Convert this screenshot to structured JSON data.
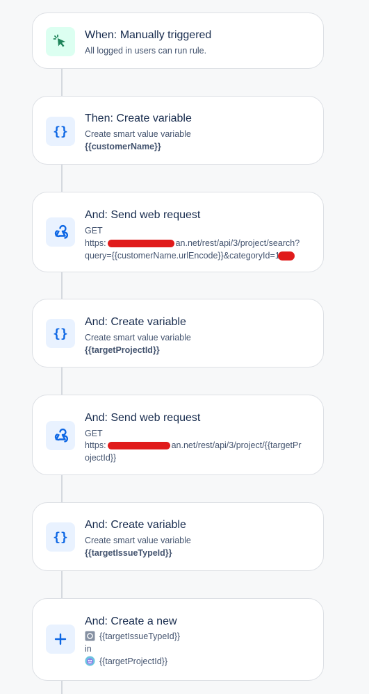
{
  "steps": [
    {
      "title": "When: Manually triggered",
      "subtitle": "All logged in users can run rule."
    },
    {
      "title": "Then: Create variable",
      "line1": "Create smart value variable",
      "value": "{{customerName}}"
    },
    {
      "title": "And: Send web request",
      "method": "GET",
      "url_prefix": "https:",
      "url_rest": "an.net/rest/api/3/project/search?",
      "url_line2": "query={{customerName.urlEncode}}&categoryId=1"
    },
    {
      "title": "And: Create variable",
      "line1": "Create smart value variable",
      "value": "{{targetProjectId}}"
    },
    {
      "title": "And: Send web request",
      "method": "GET",
      "url_prefix": "https:",
      "url_rest": "an.net/rest/api/3/project/{{targetPr",
      "url_line2": "ojectId}}"
    },
    {
      "title": "And: Create variable",
      "line1": "Create smart value variable",
      "value": "{{targetIssueTypeId}}"
    },
    {
      "title": "And: Create a new",
      "issuetype": "{{targetIssueTypeId}}",
      "in_label": "in",
      "project": "{{targetProjectId}}"
    }
  ],
  "icons": {
    "trigger": "cursor-click-icon",
    "variable": "curly-braces-icon",
    "webhook": "webhook-icon",
    "create": "plus-icon",
    "issuetype": "issue-type-icon",
    "project": "project-avatar-icon"
  },
  "colors": {
    "trigger_icon": "#1f845a",
    "action_icon": "#0c66e4",
    "redaction": "#e01b1b"
  }
}
